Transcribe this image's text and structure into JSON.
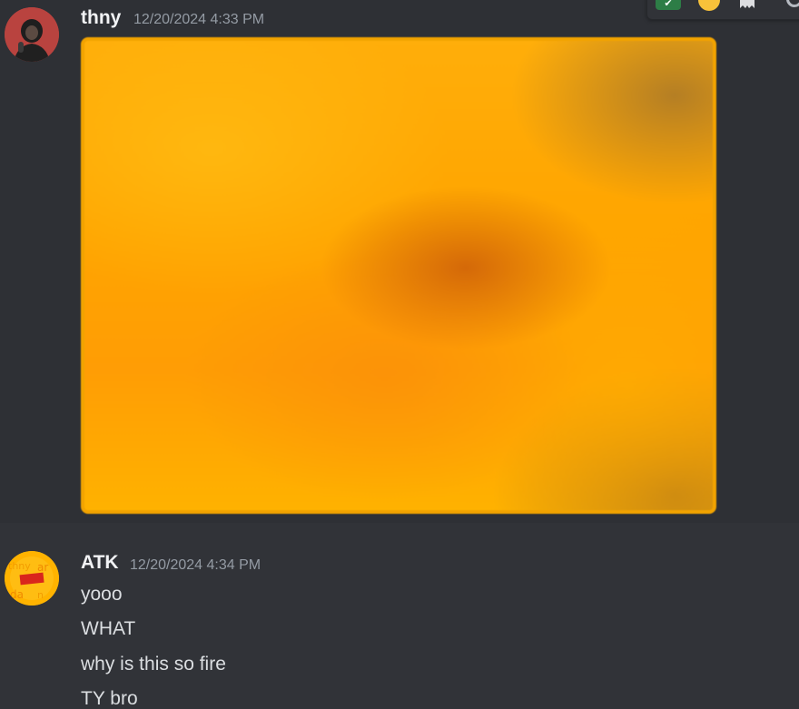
{
  "messages": [
    {
      "username": "thny",
      "timestamp": "12/20/2024 4:33 PM",
      "avatar": "thny-avatar",
      "attachment": "image-attachment"
    },
    {
      "username": "ATK",
      "timestamp": "12/20/2024 4:34 PM",
      "avatar": "atk-avatar",
      "lines": [
        "yooo",
        "WHAT",
        "why is this so fire",
        "TY bro"
      ]
    }
  ],
  "action_bar": {
    "icons": [
      "check-icon",
      "emoji-reaction-icon",
      "ghost-reaction-icon",
      "more-icon"
    ]
  },
  "colors": {
    "background": "#313338",
    "hover_background": "#2e3035",
    "username": "#f2f3f5",
    "timestamp": "#949ba4",
    "message_text": "#dbdee1",
    "attachment_border": "#f2a300"
  }
}
